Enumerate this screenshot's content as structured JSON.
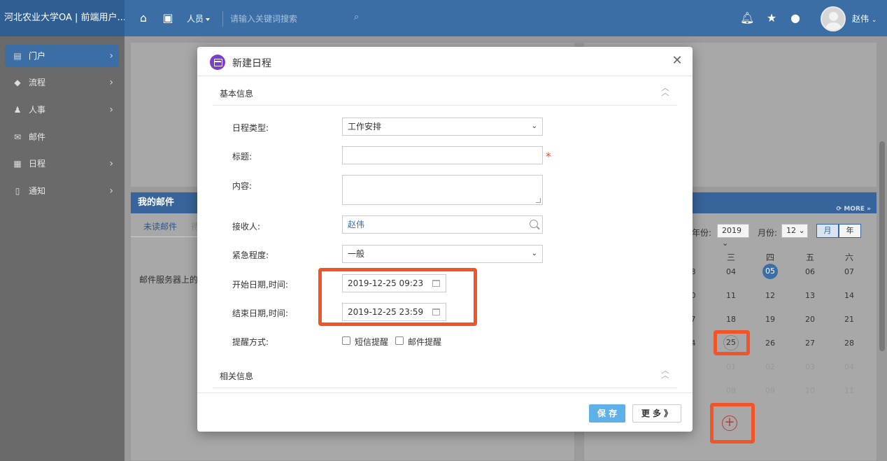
{
  "topbar": {
    "app_title": "河北农业大学OA | 前端用户...",
    "scope_label": "人员",
    "search_placeholder": "请输入关键词搜索",
    "username": "赵伟",
    "icons": [
      "home-icon",
      "apps-icon",
      "search-icon",
      "bell-icon",
      "star-icon",
      "chat-icon",
      "chevron-down-icon"
    ]
  },
  "sidebar": {
    "items": [
      {
        "label": "门户",
        "icon": "portal-icon",
        "active": true,
        "has_arrow": true
      },
      {
        "label": "流程",
        "icon": "workflow-icon",
        "active": false,
        "has_arrow": true
      },
      {
        "label": "人事",
        "icon": "person-icon",
        "active": false,
        "has_arrow": true
      },
      {
        "label": "邮件",
        "icon": "mail-icon",
        "active": false,
        "has_arrow": false
      },
      {
        "label": "日程",
        "icon": "calendar-icon",
        "active": false,
        "has_arrow": true
      },
      {
        "label": "通知",
        "icon": "clipboard-icon",
        "active": false,
        "has_arrow": true
      }
    ]
  },
  "mail_panel": {
    "title": "我的邮件",
    "tab_active": "未读邮件",
    "tab_other": "待",
    "note": "邮件服务器上的新"
  },
  "calendar_panel": {
    "more": "MORE",
    "year_label": "年份:",
    "year_value": "2019",
    "month_label": "月份:",
    "month_value": "12",
    "view_month": "月",
    "view_year": "年",
    "weekday_headers": [
      "三",
      "四",
      "五",
      "六"
    ],
    "weekday_leading": "",
    "rows": [
      [
        "8",
        "04",
        "05",
        "06",
        "07"
      ],
      [
        "0",
        "11",
        "12",
        "13",
        "14"
      ],
      [
        "7",
        "18",
        "19",
        "20",
        "21"
      ],
      [
        "4",
        "25",
        "26",
        "27",
        "28"
      ],
      [
        "",
        "01",
        "02",
        "03",
        "04"
      ],
      [
        "",
        "08",
        "09",
        "10",
        "11"
      ]
    ],
    "today": "05",
    "selected": "25"
  },
  "dialog": {
    "title": "新建日程",
    "section_basic": "基本信息",
    "section_related": "相关信息",
    "fields": {
      "type_label": "日程类型:",
      "type_value": "工作安排",
      "title_label": "标题:",
      "title_value": "",
      "content_label": "内容:",
      "content_value": "",
      "receiver_label": "接收人:",
      "receiver_value": "赵伟",
      "urgency_label": "紧急程度:",
      "urgency_value": "一般",
      "start_label": "开始日期,时间:",
      "start_value": "2019-12-25 09:23",
      "end_label": "结束日期,时间:",
      "end_value": "2019-12-25 23:59",
      "reminder_label": "提醒方式:",
      "reminder_sms": "短信提醒",
      "reminder_email": "邮件提醒"
    },
    "required_mark": "*",
    "save_label": "保 存",
    "more_label": "更 多 》"
  },
  "colors": {
    "topbar": "#3a6ea5",
    "accent": "#5eb1e8",
    "highlight": "#f0552a",
    "dialog_icon": "#7b3fc9"
  }
}
